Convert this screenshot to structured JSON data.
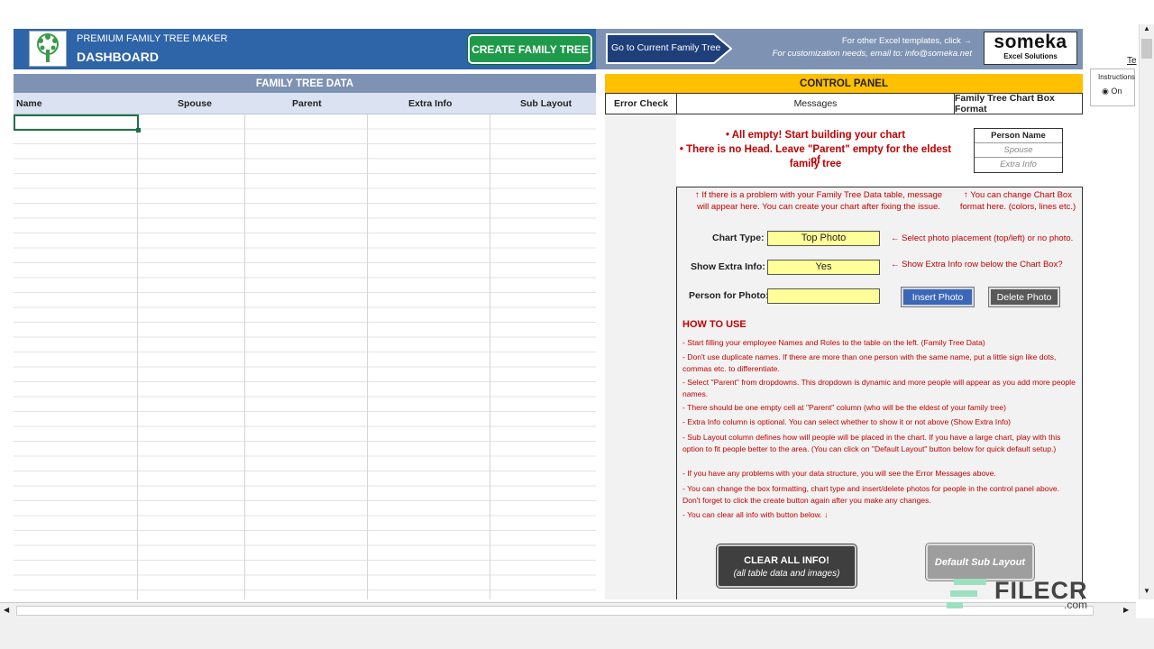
{
  "header": {
    "subtitle": "PREMIUM FAMILY TREE MAKER",
    "title": "DASHBOARD",
    "create_button": "CREATE FAMILY TREE",
    "goto_button": "Go to Current Family Tree",
    "templates_text": "For other Excel templates, click →",
    "customization_text": "For customization needs, email to: info@someka.net",
    "brand_name": "someka",
    "brand_tagline": "Excel Solutions"
  },
  "family_tree_data": {
    "title": "FAMILY TREE DATA",
    "columns": [
      "Name",
      "Spouse",
      "Parent",
      "Extra Info",
      "Sub Layout"
    ]
  },
  "control_panel": {
    "title": "CONTROL PANEL",
    "col_error": "Error Check",
    "col_messages": "Messages",
    "col_format": "Family Tree Chart Box Format",
    "messages": [
      "• All empty! Start building your chart",
      "• There is no Head. Leave \"Parent\" empty for the eldest of",
      "family tree"
    ],
    "format_box": {
      "name": "Person Name",
      "spouse": "Spouse",
      "extra": "Extra Info"
    },
    "note_left_1": "↑ If there is a problem with your Family Tree Data table, message",
    "note_left_2": "will appear here. You can create your chart after fixing the issue.",
    "note_right_1": "↑ You can change Chart Box",
    "note_right_2": "format here. (colors, lines etc.)",
    "chart_type_label": "Chart Type:",
    "chart_type_value": "Top Photo",
    "chart_type_hint": "← Select photo placement (top/left) or no photo.",
    "extra_info_label": "Show Extra Info:",
    "extra_info_value": "Yes",
    "extra_info_hint": "← Show Extra Info row below the Chart Box?",
    "photo_label": "Person for Photo:",
    "photo_value": "",
    "insert_photo": "Insert Photo",
    "delete_photo": "Delete Photo",
    "howto_title": "HOW TO USE",
    "howto": [
      "- Start filling your employee Names and Roles to the table on the left. (Family Tree Data)",
      "- Don't use duplicate names. If there are more than one person with the same name, put a little sign like dots, commas etc. to differentiate.",
      "- Select \"Parent\" from dropdowns. This dropdown is dynamic and more people will appear as you add more people names.",
      "- There should be one empty cell at \"Parent\" column (who will be the eldest of your family tree)",
      "- Extra Info column is optional. You can select whether to show it or not above (Show Extra Info)",
      "- Sub Layout column defines how will people will be placed in the chart. If you have a large chart, play with this option to fit people better to the area. (You can click on \"Default Layout\" button below for quick default setup.)",
      "- If you have any problems with your data structure, you will see the Error Messages above.",
      "- You can change the box formatting, chart type and insert/delete photos for people in the control panel above. Don't forget to click the create button again after you make any changes.",
      "- You can clear all info with button below. ↓"
    ],
    "clear_title": "CLEAR ALL INFO!",
    "clear_sub": "(all table data and images)",
    "default_layout": "Default Sub Layout"
  },
  "side": {
    "instructions": "Instructions",
    "on": "On",
    "tab": "Te"
  },
  "watermark": {
    "text": "FILECR",
    "sub": ".com"
  }
}
